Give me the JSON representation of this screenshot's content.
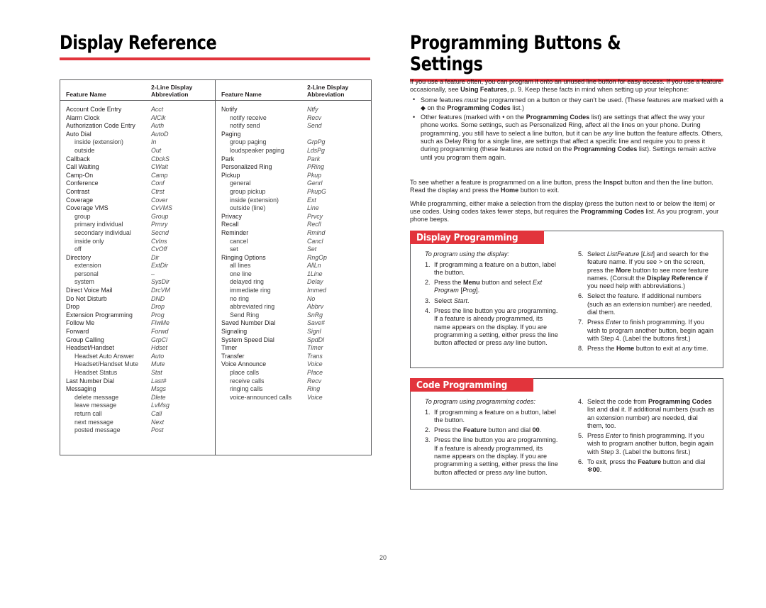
{
  "colors": {
    "accent_red": "#e2343c",
    "rule_gray": "#58595b",
    "text": "#231f20"
  },
  "page_number": "20",
  "left_page": {
    "title": "Display Reference",
    "table": {
      "headers": {
        "feature_name": "Feature Name",
        "abbreviation": "2-Line Display\nAbbreviation",
        "feature_name_line": "Feature Name",
        "abbr_l1": "2-Line Display",
        "abbr_l2": "Abbreviation"
      },
      "column_1": [
        {
          "name": "Account Code Entry",
          "abbr": "Acct",
          "sub": false
        },
        {
          "name": "Alarm Clock",
          "abbr": "AlClk",
          "sub": false
        },
        {
          "name": "Authorization Code Entry",
          "abbr": "Auth",
          "sub": false
        },
        {
          "name": "Auto Dial",
          "abbr": "AutoD",
          "sub": false
        },
        {
          "name": "inside (extension)",
          "abbr": "In",
          "sub": true
        },
        {
          "name": "outside",
          "abbr": "Out",
          "sub": true
        },
        {
          "name": "Callback",
          "abbr": "CbckS",
          "sub": false
        },
        {
          "name": "Call Waiting",
          "abbr": "CWait",
          "sub": false
        },
        {
          "name": "Camp-On",
          "abbr": "Camp",
          "sub": false
        },
        {
          "name": "Conference",
          "abbr": "Conf",
          "sub": false
        },
        {
          "name": "Contrast",
          "abbr": "Ctrst",
          "sub": false
        },
        {
          "name": "Coverage",
          "abbr": "Cover",
          "sub": false
        },
        {
          "name": "Coverage VMS",
          "abbr": "CvVMS",
          "sub": false
        },
        {
          "name": "group",
          "abbr": "Group",
          "sub": true
        },
        {
          "name": "primary individual",
          "abbr": "Prmry",
          "sub": true
        },
        {
          "name": "secondary individual",
          "abbr": "Secnd",
          "sub": true
        },
        {
          "name": "inside only",
          "abbr": "CvIns",
          "sub": true
        },
        {
          "name": "off",
          "abbr": "CvOff",
          "sub": true
        },
        {
          "name": "Directory",
          "abbr": "Dir",
          "sub": false
        },
        {
          "name": "extension",
          "abbr": "ExtDir",
          "sub": true
        },
        {
          "name": "personal",
          "abbr": "–",
          "sub": true
        },
        {
          "name": "system",
          "abbr": "SysDir",
          "sub": true
        },
        {
          "name": "Direct Voice Mail",
          "abbr": "DrcVM",
          "sub": false
        },
        {
          "name": "Do Not Disturb",
          "abbr": "DND",
          "sub": false
        },
        {
          "name": "Drop",
          "abbr": "Drop",
          "sub": false
        },
        {
          "name": "Extension Programming",
          "abbr": "Prog",
          "sub": false
        },
        {
          "name": "Follow Me",
          "abbr": "FlwMe",
          "sub": false
        },
        {
          "name": "Forward",
          "abbr": "Forwd",
          "sub": false
        },
        {
          "name": "Group Calling",
          "abbr": "GrpCl",
          "sub": false
        },
        {
          "name": "Headset/Handset",
          "abbr": "Hdset",
          "sub": false
        },
        {
          "name": "Headset Auto Answer",
          "abbr": "Auto",
          "sub": true
        },
        {
          "name": "Headset/Handset Mute",
          "abbr": "Mute",
          "sub": true
        },
        {
          "name": "Headset Status",
          "abbr": "Stat",
          "sub": true
        },
        {
          "name": "Last Number Dial",
          "abbr": "Last#",
          "sub": false
        },
        {
          "name": "Messaging",
          "abbr": "Msgs",
          "sub": false
        },
        {
          "name": "delete message",
          "abbr": "Dlete",
          "sub": true
        },
        {
          "name": "leave message",
          "abbr": "LvMsg",
          "sub": true
        },
        {
          "name": "return call",
          "abbr": "Call",
          "sub": true
        },
        {
          "name": "next message",
          "abbr": "Next",
          "sub": true
        },
        {
          "name": "posted message",
          "abbr": "Post",
          "sub": true
        }
      ],
      "column_2": [
        {
          "name": "Notify",
          "abbr": "Ntfy",
          "sub": false
        },
        {
          "name": "notify receive",
          "abbr": "Recv",
          "sub": true
        },
        {
          "name": "notify send",
          "abbr": "Send",
          "sub": true
        },
        {
          "name": "Paging",
          "abbr": "",
          "sub": false
        },
        {
          "name": "group paging",
          "abbr": "GrpPg",
          "sub": true
        },
        {
          "name": "loudspeaker paging",
          "abbr": "LdsPg",
          "sub": true
        },
        {
          "name": "Park",
          "abbr": "Park",
          "sub": false
        },
        {
          "name": "Personalized Ring",
          "abbr": "PRing",
          "sub": false
        },
        {
          "name": "Pickup",
          "abbr": "Pkup",
          "sub": false
        },
        {
          "name": "general",
          "abbr": "Genrl",
          "sub": true
        },
        {
          "name": "group pickup",
          "abbr": "PkupG",
          "sub": true
        },
        {
          "name": "inside (extension)",
          "abbr": "Ext",
          "sub": true
        },
        {
          "name": "outside (line)",
          "abbr": "Line",
          "sub": true
        },
        {
          "name": "Privacy",
          "abbr": "Prvcy",
          "sub": false
        },
        {
          "name": "Recall",
          "abbr": "Recll",
          "sub": false
        },
        {
          "name": "Reminder",
          "abbr": "Rmind",
          "sub": false
        },
        {
          "name": "cancel",
          "abbr": "Cancl",
          "sub": true
        },
        {
          "name": "set",
          "abbr": "Set",
          "sub": true
        },
        {
          "name": "Ringing Options",
          "abbr": "RngOp",
          "sub": false
        },
        {
          "name": "all lines",
          "abbr": "AllLn",
          "sub": true
        },
        {
          "name": "one line",
          "abbr": "1Line",
          "sub": true
        },
        {
          "name": "delayed ring",
          "abbr": "Delay",
          "sub": true
        },
        {
          "name": "immediate ring",
          "abbr": "Immed",
          "sub": true
        },
        {
          "name": "no ring",
          "abbr": "No",
          "sub": true
        },
        {
          "name": "abbreviated ring",
          "abbr": "Abbrv",
          "sub": true
        },
        {
          "name": "Send Ring",
          "abbr": "SnRg",
          "sub": true
        },
        {
          "name": "Saved Number Dial",
          "abbr": "Save#",
          "sub": false
        },
        {
          "name": "Signaling",
          "abbr": "Signl",
          "sub": false
        },
        {
          "name": "System Speed Dial",
          "abbr": "SpdDl",
          "sub": false
        },
        {
          "name": "Timer",
          "abbr": "Timer",
          "sub": false
        },
        {
          "name": "Transfer",
          "abbr": "Trans",
          "sub": false
        },
        {
          "name": "Voice Announce",
          "abbr": "Voice",
          "sub": false
        },
        {
          "name": "place calls",
          "abbr": "Place",
          "sub": true
        },
        {
          "name": "receive calls",
          "abbr": "Recv",
          "sub": true
        },
        {
          "name": "ringing calls",
          "abbr": "Ring",
          "sub": true
        },
        {
          "name": "voice-announced calls",
          "abbr": "Voice",
          "sub": true
        }
      ]
    }
  },
  "right_page": {
    "title": "Programming Buttons & Settings",
    "intro": "If you use a feature often, you can program it onto an unused line button for easy access. If you use a feature occasionally, see Using Features, p. 9. Keep these facts in mind when setting up your telephone:",
    "bullets": [
      "Some features must be programmed on a button or they can’t be used. (These features are marked with a ◆ on the Programming Codes list.)",
      "Other features (marked with • on the Programming Codes list) are settings that affect the way your phone works. Some settings, such as Personalized Ring, affect all the lines on your phone. During programming, you still have to select a line button, but it can be any line button the feature affects. Others, such as Delay Ring for a single line, are settings that affect a specific line and require you to press it during programming (these features are noted on the Programming Codes list). Settings remain active until you program them again."
    ],
    "para_inspect": "To see whether a feature is programmed on a line button, press the Inspct button and then the line button. Read the display and press the Home button to exit.",
    "para_codes": "While programming, either make a selection from the display (press the button next to or below the item) or use codes. Using codes takes fewer steps, but requires the Programming Codes list. As you program, your phone beeps.",
    "display_programming": {
      "banner": "Display Programming",
      "lead_in": "To program using the display:",
      "steps_left": [
        {
          "num": "1.",
          "text": "If programming a feature on a button, label the button."
        },
        {
          "num": "2.",
          "text": "Press the Menu button and select Ext Program [Prog]."
        },
        {
          "num": "3.",
          "text": "Select Start."
        },
        {
          "num": "4.",
          "text": "Press the line button you are programming. If a feature is already programmed, its name appears on the display. If you are programming a setting, either press the line button affected or press any line button."
        }
      ],
      "steps_right": [
        {
          "num": "5.",
          "text": "Select ListFeature [List] and search for the feature name. If you see > on the screen, press the More button to see more feature names. (Consult the Display Reference if you need help with abbreviations.)"
        },
        {
          "num": "6.",
          "text": "Select the feature. If additional numbers (such as an extension number) are needed, dial them."
        },
        {
          "num": "7.",
          "text": "Press Enter to finish programming. If you wish to program another button, begin again with Step 4. (Label the buttons first.)"
        },
        {
          "num": "8.",
          "text": "Press the Home button to exit at any time."
        }
      ]
    },
    "code_programming": {
      "banner": "Code Programming",
      "lead_in": "To program using programming codes:",
      "steps_left": [
        {
          "num": "1.",
          "text": "If programming a feature on a button, label the button."
        },
        {
          "num": "2.",
          "text": "Press the Feature button and dial 00."
        },
        {
          "num": "3.",
          "text": "Press the line button you are programming. If a feature is already programmed, its name appears on the display. If you are programming a setting, either press the line button affected or press any line button."
        }
      ],
      "steps_right": [
        {
          "num": "4.",
          "text": "Select the code from Programming Codes list and dial it. If additional numbers (such as an extension number) are needed, dial them, too."
        },
        {
          "num": "5.",
          "text": "Press Enter to finish programming. If you wish to program another button, begin again with Step 3. (Label the buttons first.)"
        },
        {
          "num": "6.",
          "text": "To exit, press the Feature button and dial ✻00."
        }
      ]
    }
  }
}
